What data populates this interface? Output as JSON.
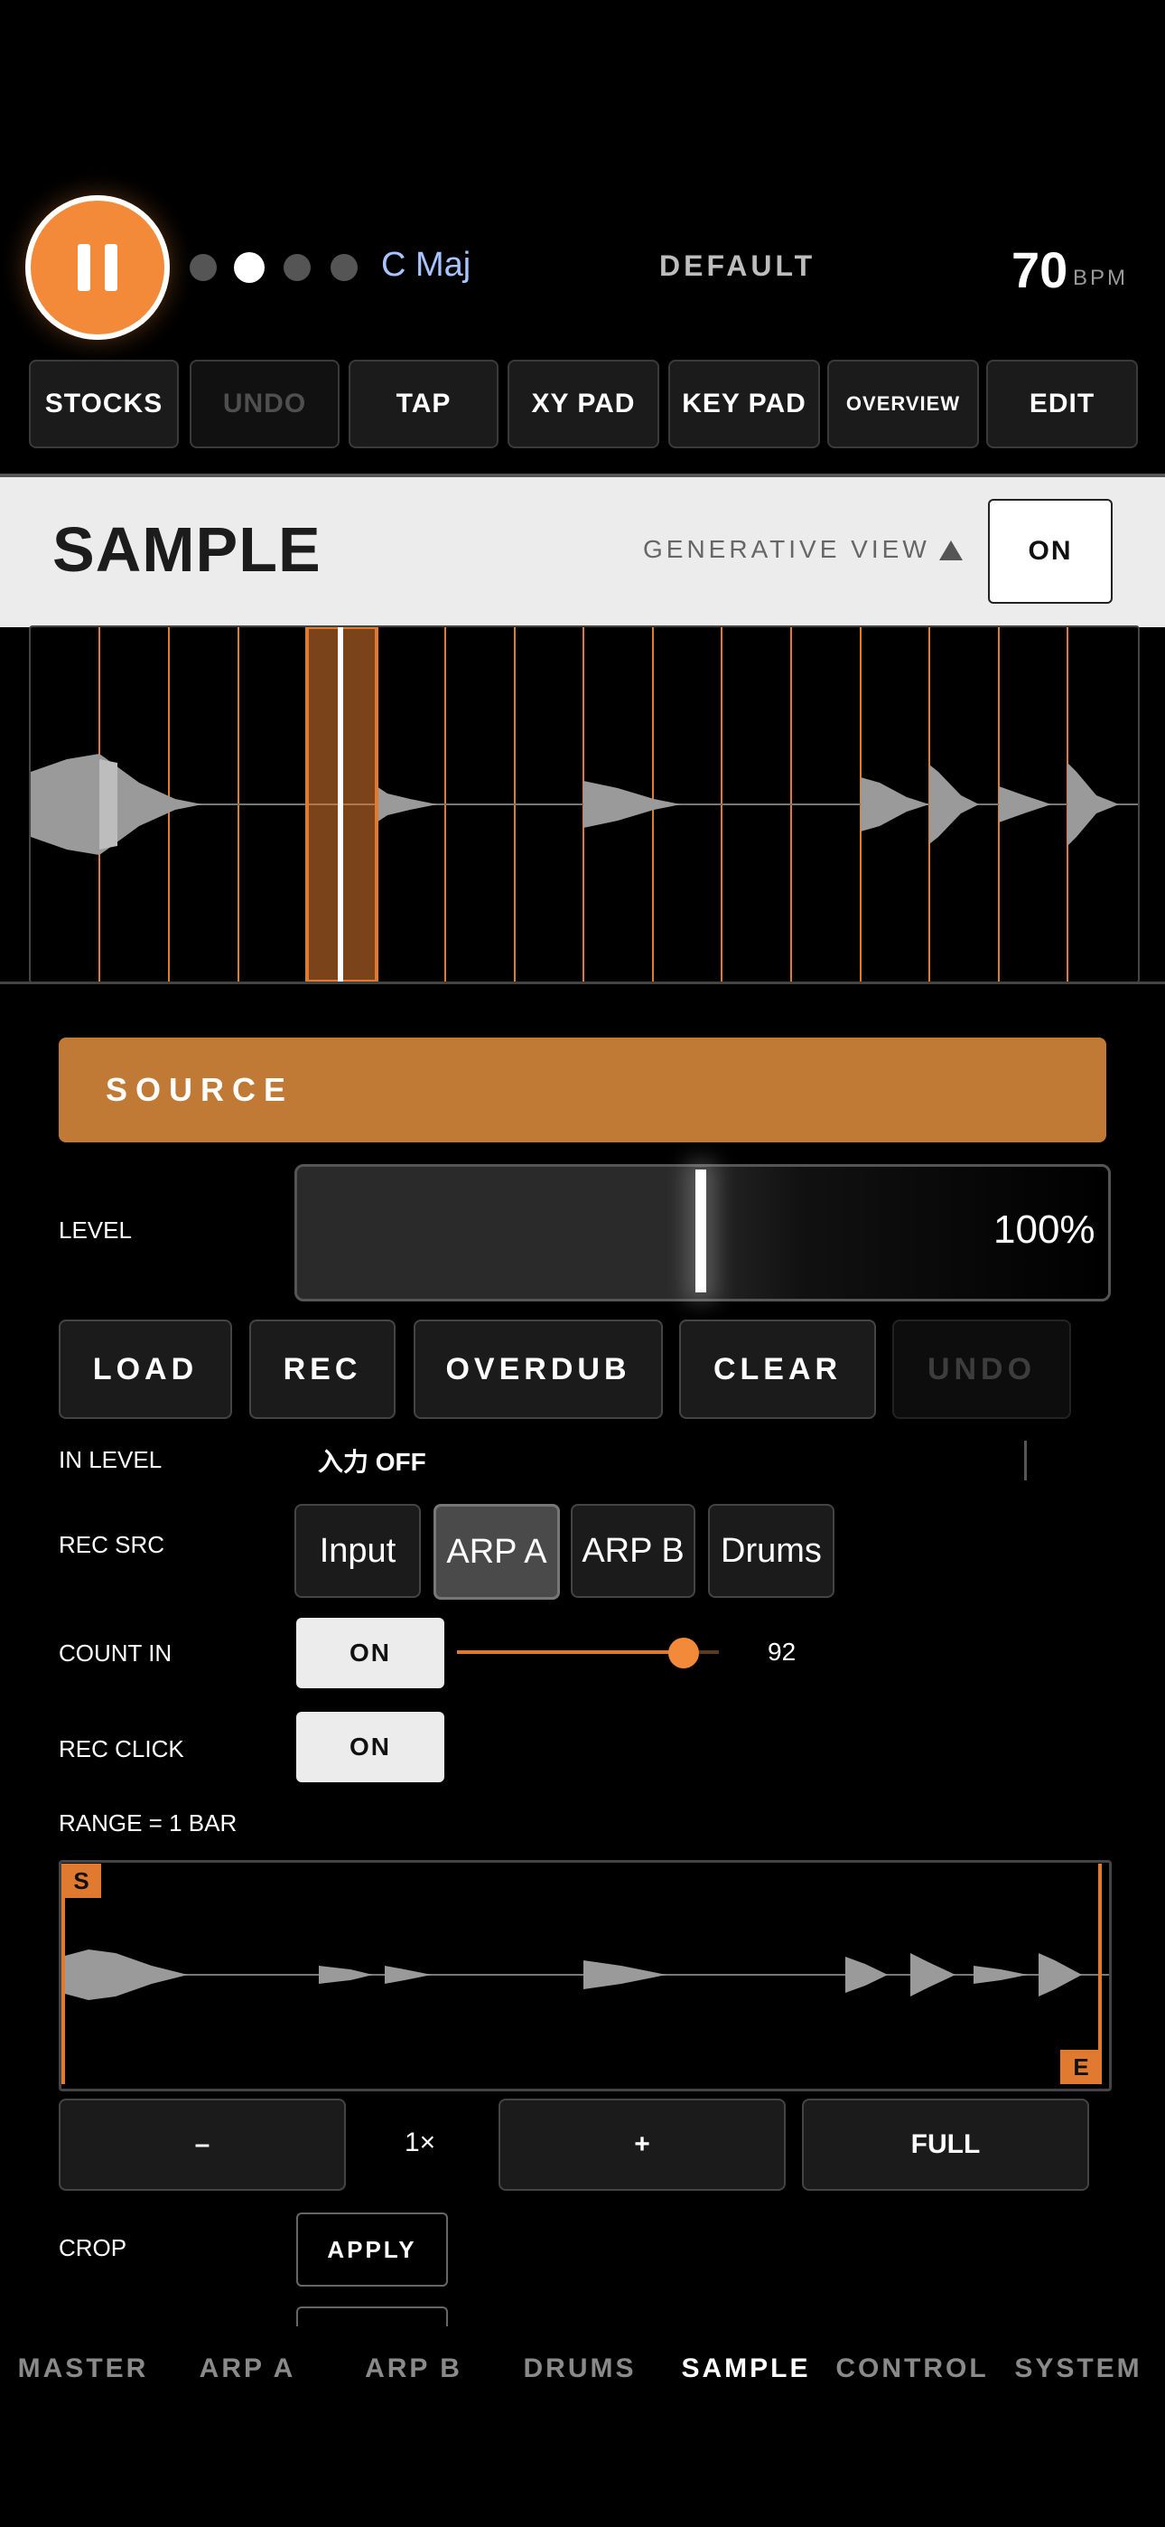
{
  "header": {
    "key": "C Maj",
    "preset": "DEFAULT",
    "bpm": "70",
    "bpm_label": "BPM",
    "page_dots": 4,
    "active_dot": 2
  },
  "toolbar": {
    "stocks": "STOCKS",
    "undo": "UNDO",
    "tap": "TAP",
    "xy_pad": "XY PAD",
    "key_pad": "KEY PAD",
    "overview": "OVERVIEW",
    "edit": "EDIT"
  },
  "sample_header": {
    "title": "SAMPLE",
    "generative_view": "GENERATIVE VIEW",
    "toggle": "ON"
  },
  "source": {
    "title": "SOURCE",
    "level_label": "LEVEL",
    "level_value": "100%",
    "buttons": {
      "load": "LOAD",
      "rec": "REC",
      "overdub": "OVERDUB",
      "clear": "CLEAR",
      "undo": "UNDO"
    },
    "in_level_label": "IN LEVEL",
    "in_level_value": "入力 OFF",
    "rec_src_label": "REC SRC",
    "rec_src_options": [
      "Input",
      "ARP A",
      "ARP B",
      "Drums"
    ],
    "rec_src_selected": "ARP A",
    "count_in_label": "COUNT IN",
    "count_in_toggle": "ON",
    "count_in_value": "92",
    "rec_click_label": "REC CLICK",
    "rec_click_toggle": "ON",
    "range_label": "RANGE = 1 BAR",
    "start_marker": "S",
    "end_marker": "E",
    "zoom_minus": "–",
    "zoom_value": "1×",
    "zoom_plus": "+",
    "zoom_full": "FULL",
    "crop_label": "CROP",
    "apply": "APPLY"
  },
  "nav": {
    "items": [
      "MASTER",
      "ARP A",
      "ARP B",
      "DRUMS",
      "SAMPLE",
      "CONTROL",
      "SYSTEM"
    ],
    "active": "SAMPLE"
  },
  "colors": {
    "accent": "#f28a3a",
    "source_bar": "#c17a35",
    "key_label": "#a6c4ff"
  }
}
